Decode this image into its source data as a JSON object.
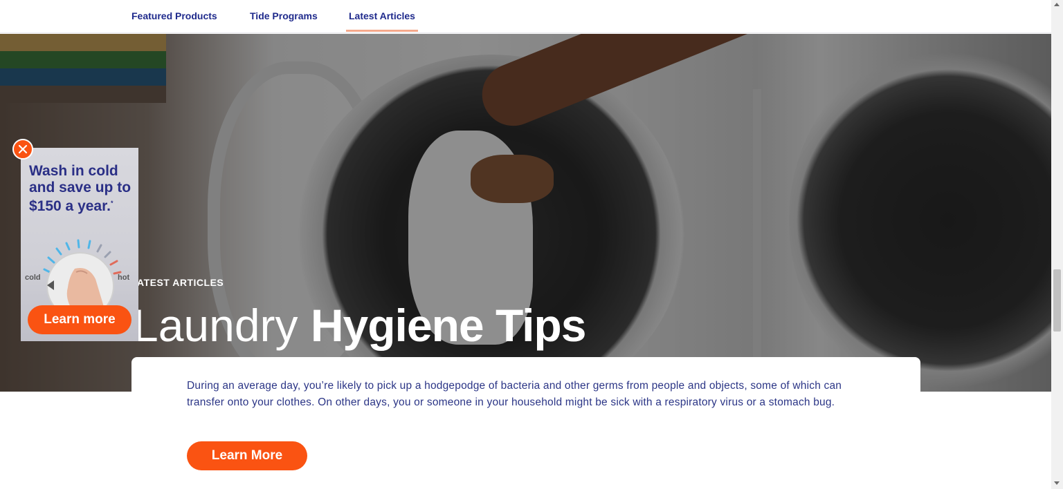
{
  "nav": {
    "tabs": [
      {
        "label": "Featured Products",
        "active": false
      },
      {
        "label": "Tide Programs",
        "active": false
      },
      {
        "label": "Latest Articles",
        "active": true
      }
    ],
    "active_underline_color": "#f6a98c",
    "text_color": "#1f2a8c"
  },
  "hero": {
    "eyebrow": "ATEST ARTICLES",
    "headline_light": "Laundry ",
    "headline_bold": "Hygiene Tips",
    "image_icon": "washing-machine-photo"
  },
  "card": {
    "body": "During an average day, you’re likely to pick up a hodgepodge of bacteria and other germs from people and objects, some of which can transfer onto your clothes. On other days, you or someone in your household might be sick with a respiratory virus or a stomach bug.",
    "button_label": "Learn More"
  },
  "ad": {
    "title": "Wash in cold and save up to $150 a year.",
    "asterisk": "*",
    "dial_left_label": "cold",
    "dial_right_label": "hot",
    "button_label": "Learn more",
    "close_icon": "close-icon"
  },
  "colors": {
    "accent": "#fa5312",
    "brand_text": "#2b3586"
  }
}
